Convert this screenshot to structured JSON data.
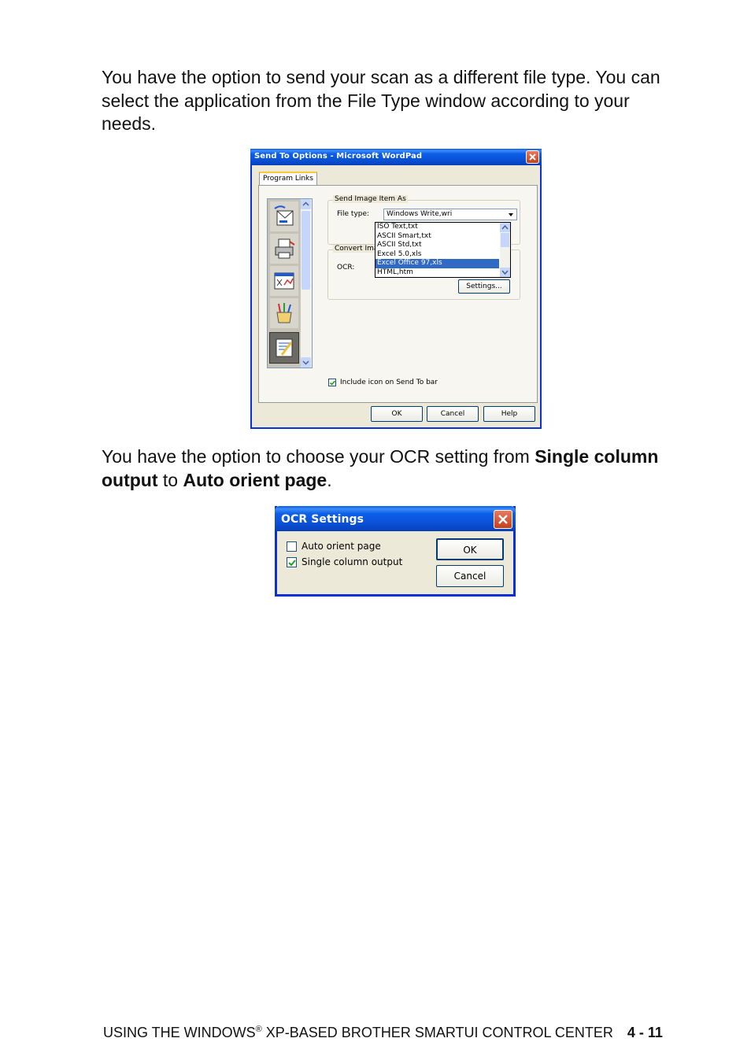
{
  "paragraph1": "You have the option to send your scan as a different file type. You can select the application from the File Type window according to your needs.",
  "paragraph2": {
    "prefix": "You have the option to choose your OCR setting from ",
    "bold1": "Single column output",
    "middle": " to ",
    "bold2": "Auto orient page",
    "suffix": "."
  },
  "send_dialog": {
    "title": "Send To Options - Microsoft WordPad",
    "tab": "Program Links",
    "group_send": "Send Image Item As",
    "file_type_label": "File type:",
    "file_type_value": "Windows Write,wri",
    "file_type_options": [
      "ISO Text,txt",
      "ASCII Smart,txt",
      "ASCII Std,txt",
      "Excel 5.0,xls",
      "Excel Office 97,xls",
      "HTML,htm"
    ],
    "file_type_selected_index": 4,
    "group_convert": "Convert Ima",
    "ocr_label": "OCR:",
    "settings_button": "Settings...",
    "include_icon_label": "Include icon on Send To bar",
    "include_icon_checked": true,
    "ok": "OK",
    "cancel": "Cancel",
    "help": "Help",
    "sidebar_icons": [
      "email-scan-icon",
      "printer-scan-icon",
      "ocr-scan-icon",
      "paint-brushes-icon",
      "wordpad-notepad-icon"
    ],
    "selected_sidebar_index": 4
  },
  "ocr_dialog": {
    "title": "OCR Settings",
    "auto_orient_label": "Auto orient page",
    "auto_orient_checked": false,
    "single_column_label": "Single column output",
    "single_column_checked": true,
    "ok": "OK",
    "cancel": "Cancel"
  },
  "footer": {
    "text_before": "USING THE WINDOWS",
    "registered": "®",
    "text_after": " XP-BASED BROTHER SMARTUI CONTROL CENTER",
    "page": "4 - 11"
  },
  "colors": {
    "titlebar": "#0a50d6",
    "dialog_face": "#ece9d8",
    "selection": "#316ac5",
    "close_button": "#c4401e"
  }
}
